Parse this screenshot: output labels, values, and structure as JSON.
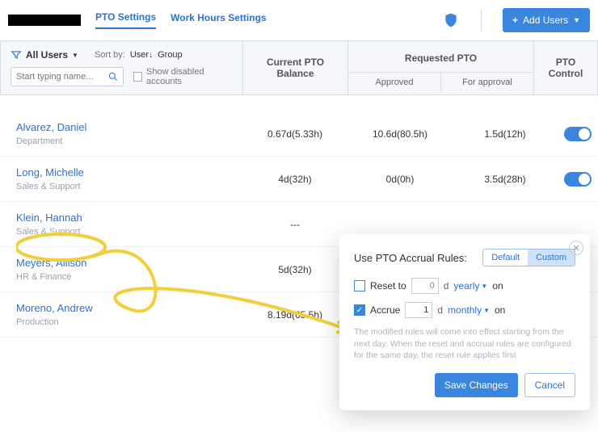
{
  "topbar": {
    "tab_active": "PTO Settings",
    "tab_other": "Work Hours Settings",
    "add_users": "+  Add Users"
  },
  "filter": {
    "all_users": "All Users",
    "sort_label": "Sort by:",
    "sort_user": "User",
    "sort_group": "Group",
    "search_placeholder": "Start typing name...",
    "show_disabled": "Show disabled accounts",
    "current_balance": "Current PTO Balance",
    "requested": "Requested PTO",
    "approved": "Approved",
    "for_approval": "For approval",
    "control": "PTO Control"
  },
  "rows": [
    {
      "name": "Alvarez, Daniel",
      "dept": "Department",
      "balance": "0.67d(5.33h)",
      "approved": "10.6d(80.5h)",
      "for_approval": "1.5d(12h)",
      "toggle": true
    },
    {
      "name": "Long, Michelle",
      "dept": "Sales & Support",
      "balance": "4d(32h)",
      "approved": "0d(0h)",
      "for_approval": "3.5d(28h)",
      "toggle": true
    },
    {
      "name": "Klein, Hannah",
      "dept": "Sales & Support",
      "balance": "---",
      "approved": "",
      "for_approval": "",
      "toggle": false
    },
    {
      "name": "Meyers, Allison",
      "dept": "HR & Finance",
      "balance": "5d(32h)",
      "approved": "",
      "for_approval": "",
      "toggle": false
    },
    {
      "name": "Moreno, Andrew",
      "dept": "Production",
      "balance": "8.19d(65.5h)",
      "approved": "",
      "for_approval": "",
      "toggle": false
    }
  ],
  "popup": {
    "title": "Use PTO Accrual Rules:",
    "seg_default": "Default",
    "seg_custom": "Custom",
    "reset_label": "Reset to",
    "reset_value": "0",
    "reset_unit": "d",
    "reset_freq": "yearly",
    "on": "on",
    "accrue_label": "Accrue",
    "accrue_value": "1",
    "accrue_unit": "d",
    "accrue_freq": "monthly",
    "note": "The modified rules will come into effect starting from the next day. When the reset and accrual rules are configured for the same day, the reset rule applies first",
    "save": "Save Changes",
    "cancel": "Cancel"
  }
}
